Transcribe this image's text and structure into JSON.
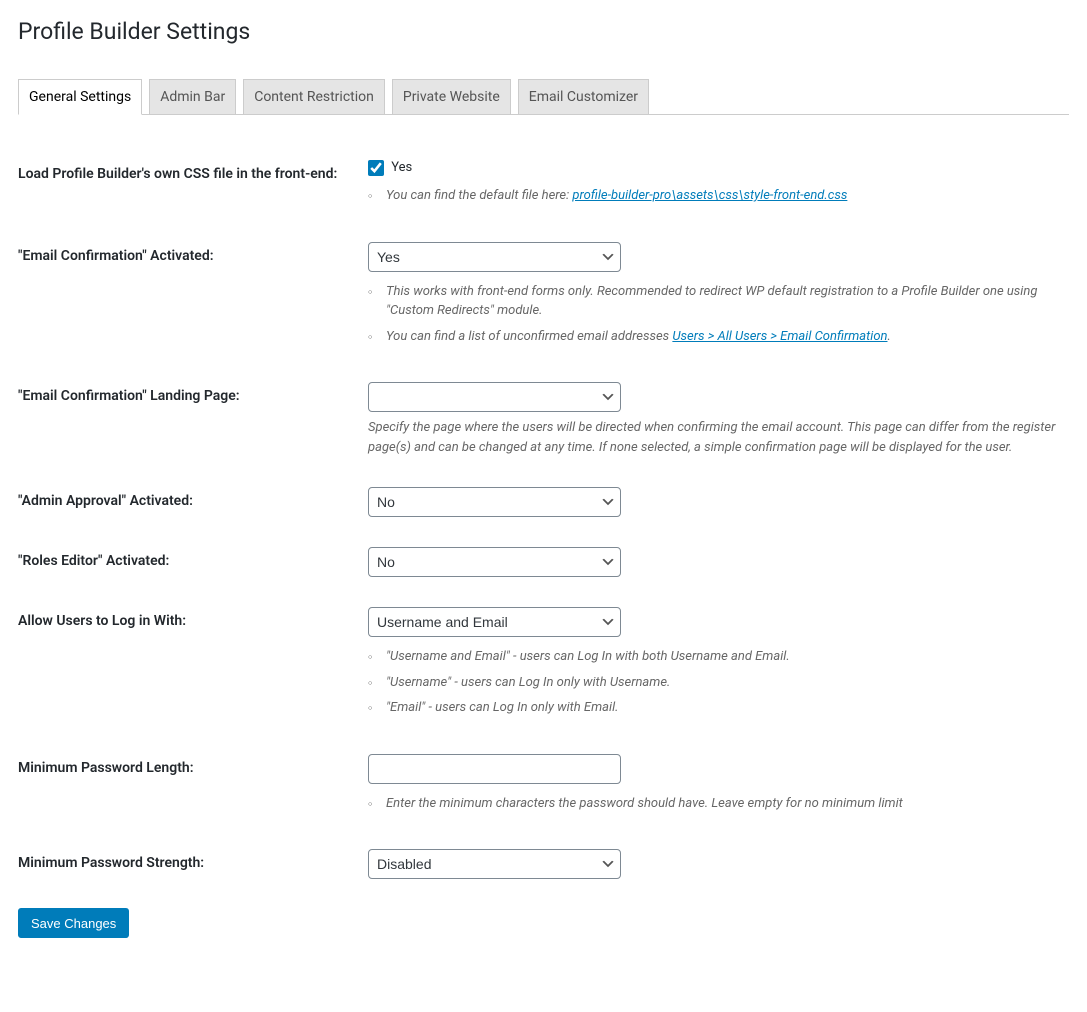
{
  "title": "Profile Builder Settings",
  "tabs": [
    {
      "label": "General Settings"
    },
    {
      "label": "Admin Bar"
    },
    {
      "label": "Content Restriction"
    },
    {
      "label": "Private Website"
    },
    {
      "label": "Email Customizer"
    }
  ],
  "fields": {
    "load_css": {
      "label": "Load Profile Builder's own CSS file in the front-end:",
      "checkbox_label": "Yes",
      "help_prefix": "You can find the default file here: ",
      "help_link": "profile-builder-pro\\assets\\css\\style-front-end.css"
    },
    "email_confirmation": {
      "label": "\"Email Confirmation\" Activated:",
      "value": "Yes",
      "help1": "This works with front-end forms only. Recommended to redirect WP default registration to a Profile Builder one using \"Custom Redirects\" module.",
      "help2_prefix": "You can find a list of unconfirmed email addresses ",
      "help2_link": "Users > All Users > Email Confirmation",
      "help2_suffix": "."
    },
    "email_confirmation_landing": {
      "label": "\"Email Confirmation\" Landing Page:",
      "value": "",
      "help": "Specify the page where the users will be directed when confirming the email account. This page can differ from the register page(s) and can be changed at any time. If none selected, a simple confirmation page will be displayed for the user."
    },
    "admin_approval": {
      "label": "\"Admin Approval\" Activated:",
      "value": "No"
    },
    "roles_editor": {
      "label": "\"Roles Editor\" Activated:",
      "value": "No"
    },
    "login_with": {
      "label": "Allow Users to Log in With:",
      "value": "Username and Email",
      "help1": "\"Username and Email\" - users can Log In with both Username and Email.",
      "help2": "\"Username\" - users can Log In only with Username.",
      "help3": "\"Email\" - users can Log In only with Email."
    },
    "min_password_length": {
      "label": "Minimum Password Length:",
      "value": "",
      "help": "Enter the minimum characters the password should have. Leave empty for no minimum limit"
    },
    "min_password_strength": {
      "label": "Minimum Password Strength:",
      "value": "Disabled"
    }
  },
  "save_button": "Save Changes"
}
